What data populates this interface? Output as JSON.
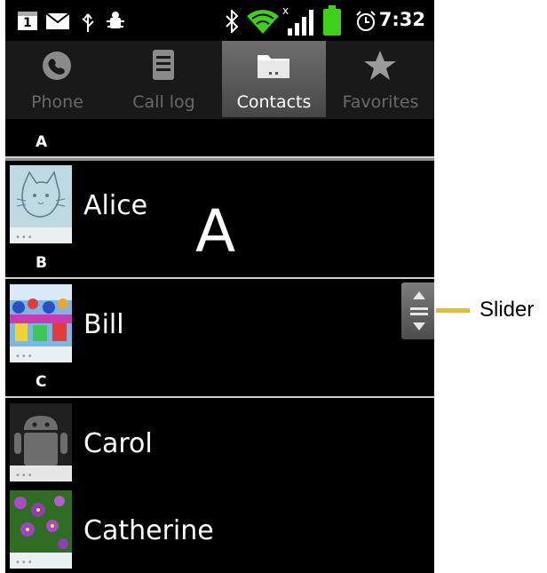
{
  "status_bar": {
    "time": "7:32",
    "icons": [
      "calendar-icon",
      "mail-icon",
      "usb-icon",
      "debug-icon",
      "bluetooth-icon",
      "wifi-icon",
      "signal-icon",
      "battery-icon",
      "alarm-icon"
    ],
    "calendar_day": "1"
  },
  "tabs": [
    {
      "label": "Phone",
      "icon": "phone-icon",
      "selected": false
    },
    {
      "label": "Call log",
      "icon": "call-log-icon",
      "selected": false
    },
    {
      "label": "Contacts",
      "icon": "contacts-icon",
      "selected": true
    },
    {
      "label": "Favorites",
      "icon": "star-icon",
      "selected": false
    }
  ],
  "contacts": {
    "sections": [
      {
        "letter": "A",
        "items": [
          {
            "name": "Alice"
          }
        ]
      },
      {
        "letter": "B",
        "items": [
          {
            "name": "Bill"
          }
        ]
      },
      {
        "letter": "C",
        "items": [
          {
            "name": "Carol"
          },
          {
            "name": "Catherine"
          }
        ]
      }
    ],
    "fast_scroll_letter": "A"
  },
  "annotation": {
    "label": "Slider",
    "color": "#e2c21a"
  }
}
